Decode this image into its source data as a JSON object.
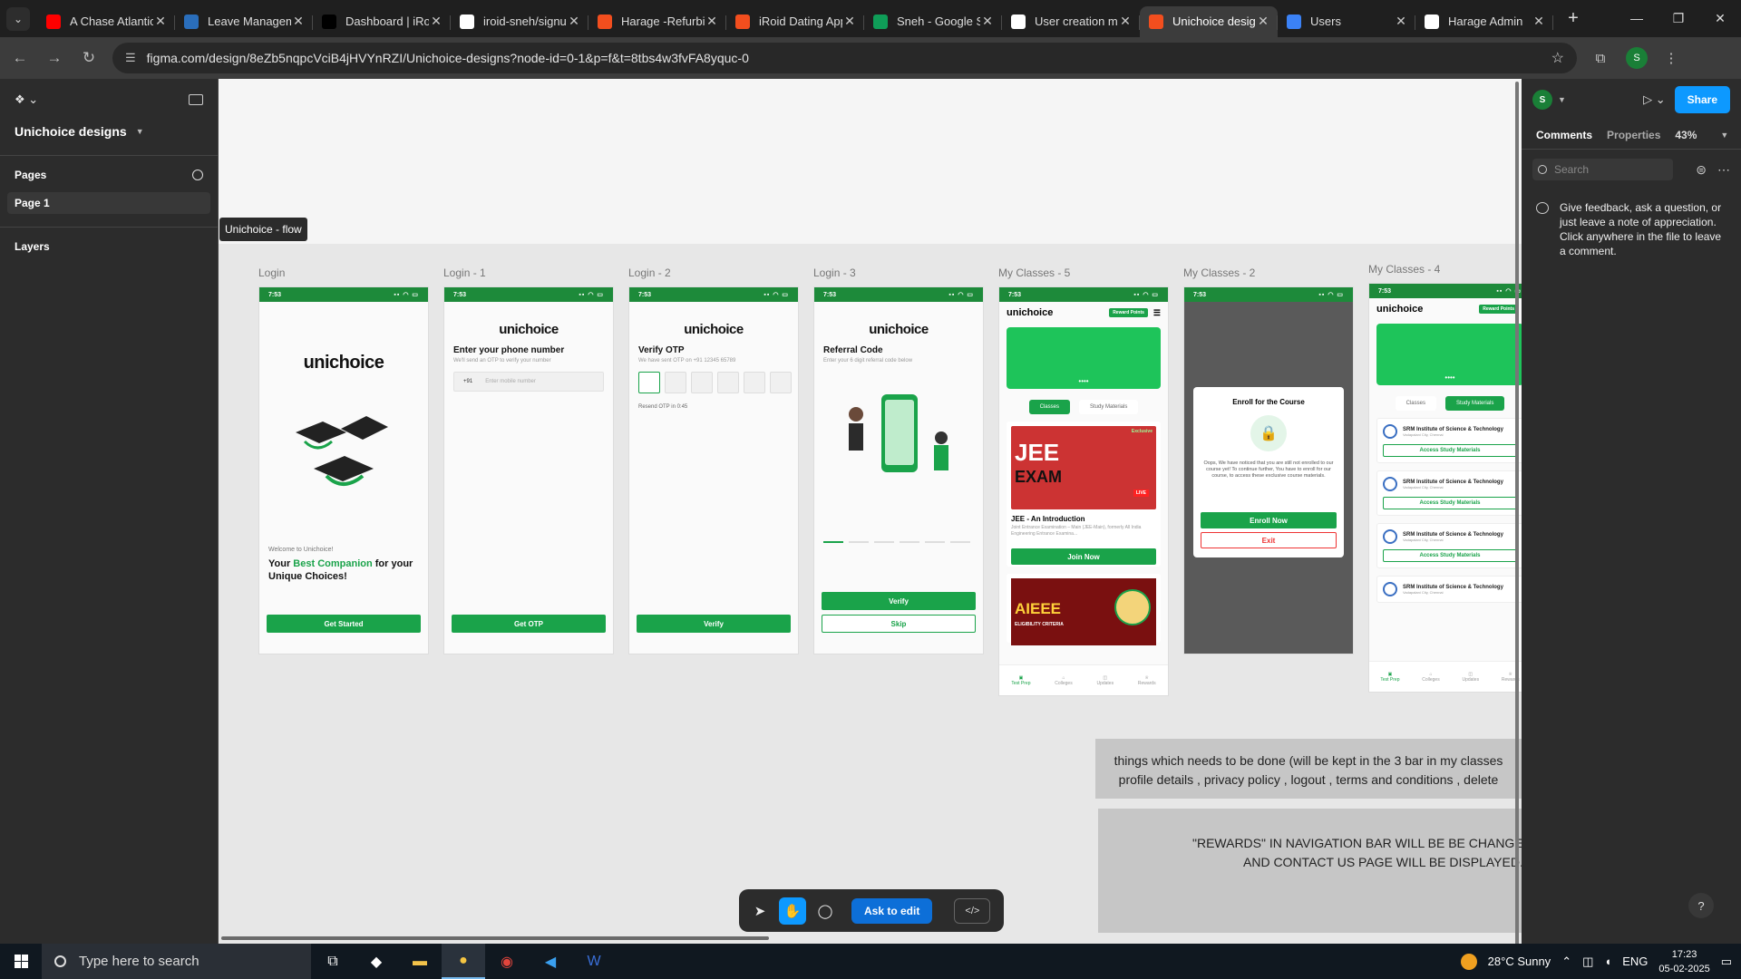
{
  "browser": {
    "tabs": [
      {
        "title": "A Chase Atlantic",
        "icon": "youtube-icon",
        "color": "#ff0000"
      },
      {
        "title": "Leave Management",
        "icon": "leave-app-icon",
        "color": "#2a6ebb"
      },
      {
        "title": "Dashboard | iRoid",
        "icon": "iroid-icon",
        "color": "#000000"
      },
      {
        "title": "iroid-sneh/signup",
        "icon": "github-icon",
        "color": "#ffffff"
      },
      {
        "title": "Harage -Refurbished",
        "icon": "figma-icon",
        "color": "#f24e1e"
      },
      {
        "title": "iRoid Dating App",
        "icon": "figma-icon",
        "color": "#f24e1e"
      },
      {
        "title": "Sneh - Google Sheets",
        "icon": "sheets-icon",
        "color": "#0f9d58"
      },
      {
        "title": "User creation module",
        "icon": "chatgpt-icon",
        "color": "#ffffff"
      },
      {
        "title": "Unichoice designs",
        "icon": "figma-icon",
        "color": "#f24e1e"
      },
      {
        "title": "Users",
        "icon": "cloud-icon",
        "color": "#3b82f6"
      },
      {
        "title": "Harage Admin",
        "icon": "harage-icon",
        "color": "#ffffff"
      }
    ],
    "new_tab": "+",
    "url": "figma.com/design/8eZb5nqpcVciB4jHVYnRZI/Unichoice-designs?node-id=0-1&p=f&t=8tbs4w3fvFA8yquc-0",
    "profile_initial": "S"
  },
  "figma": {
    "file_name": "Unichoice designs",
    "pages_label": "Pages",
    "page_item": "Page 1",
    "layers_label": "Layers",
    "section_label": "Unichoice - flow",
    "frames": {
      "login": {
        "label": "Login",
        "time": "7:53",
        "brand": "unichoice",
        "welcome": "Welcome to Unichoice!",
        "tag_a": "Your ",
        "tag_hl": "Best Companion",
        "tag_b": " for your Unique Choices!",
        "button": "Get Started"
      },
      "login1": {
        "label": "Login - 1",
        "time": "7:53",
        "brand": "unichoice",
        "title": "Enter your phone number",
        "subtitle": "We'll send an OTP to verify your number",
        "code": "+91",
        "placeholder": "Enter mobile number",
        "button": "Get OTP"
      },
      "login2": {
        "label": "Login - 2",
        "time": "7:53",
        "brand": "unichoice",
        "title": "Verify OTP",
        "subtitle": "We have sent OTP on +91 12345 65789",
        "resend": "Resend OTP in 0:45",
        "button": "Verify"
      },
      "login3": {
        "label": "Login - 3",
        "time": "7:53",
        "brand": "unichoice",
        "title": "Referral Code",
        "subtitle": "Enter your 6 digit referral code below",
        "button": "Verify",
        "skip": "Skip"
      },
      "classes5": {
        "label": "My Classes - 5",
        "time": "7:53",
        "brand": "unichoice",
        "reward": "Reward Points",
        "tab_a": "Classes",
        "tab_b": "Study Materials",
        "badge": "Exclusive",
        "jee_a": "JEE",
        "jee_b": "EXAM",
        "live": "LIVE",
        "card_title": "JEE - An Introduction",
        "card_desc": "Joint Entrance Examination – Main (JEE-Main), formerly All India Engineering Entrance Examina...",
        "join": "Join Now",
        "aieee": "AIEEE",
        "aieee_sub": "ELIGIBILITY CRITERIA",
        "nav": [
          "Test Prep",
          "Colleges",
          "Updates",
          "Rewards"
        ]
      },
      "classes2": {
        "label": "My Classes - 2",
        "time": "7:53",
        "modal_title": "Enroll for the Course",
        "modal_text": "Oops, We have noticed that you are still not enrolled to our course yet! To continue further, You have to enroll for our course, to access these exclusive course materials.",
        "enroll": "Enroll Now",
        "exit": "Exit"
      },
      "classes4": {
        "label": "My Classes - 4",
        "time": "7:53",
        "brand": "unichoice",
        "reward": "Reward Points",
        "tab_a": "Classes",
        "tab_b": "Study Materials",
        "uni": "SRM Institute of Science & Technology",
        "loc": "Vadapalani City, Chennai",
        "access": "Access Study Materials",
        "nav": [
          "Test Prep",
          "Colleges",
          "Updates",
          "Rewards"
        ]
      }
    },
    "notes": {
      "note1_l1": "things which needs to be done (will be kept in the 3 bar in  my classes",
      "note1_l2": "profile details , privacy policy , logout , terms and conditions , delete",
      "note2_l1": "\"REWARDS\" IN NAVIGATION BAR WILL BE BE CHANGED TO",
      "note2_l2": "AND CONTACT US PAGE WILL BE DISPLAYED."
    },
    "toolbar": {
      "ask_to_edit": "Ask to edit",
      "code": "</>"
    },
    "right": {
      "user_initial": "S",
      "share": "Share",
      "tab_comments": "Comments",
      "tab_properties": "Properties",
      "zoom": "43%",
      "search_placeholder": "Search",
      "hint": "Give feedback, ask a question, or just leave a note of appreciation. Click anywhere in the file to leave a comment."
    },
    "help": "?"
  },
  "taskbar": {
    "search_placeholder": "Type here to search",
    "weather": "28°C  Sunny",
    "lang": "ENG",
    "time": "17:23",
    "date": "05-02-2025"
  },
  "colors": {
    "primary_green": "#1aa34a",
    "figma_blue": "#0d99ff"
  }
}
